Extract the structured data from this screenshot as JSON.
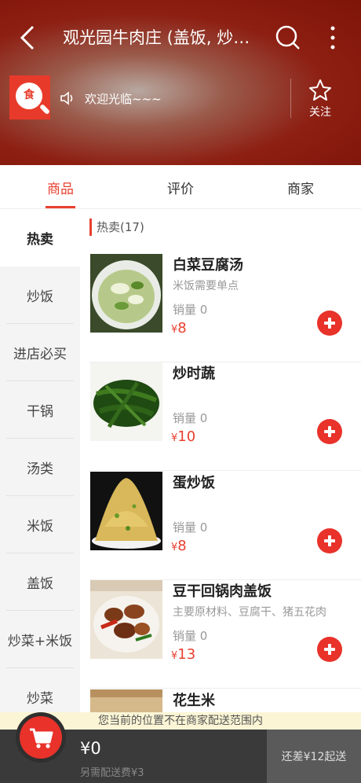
{
  "nav": {
    "title": "观光园牛肉庄 (盖饭, 炒饭, 面条, 水饺)",
    "back_icon": "chevron-left-icon",
    "search_icon": "search-icon",
    "more_icon": "more-vertical-icon"
  },
  "shop": {
    "logo_text": "食",
    "welcome": "欢迎光临~~~",
    "favorite_label": "关注"
  },
  "tabs": [
    {
      "label": "商品",
      "active": true
    },
    {
      "label": "评价",
      "active": false
    },
    {
      "label": "商家",
      "active": false
    }
  ],
  "categories": [
    {
      "label": "热卖",
      "active": true
    },
    {
      "label": "炒饭"
    },
    {
      "label": "进店必买"
    },
    {
      "label": "干锅"
    },
    {
      "label": "汤类"
    },
    {
      "label": "米饭"
    },
    {
      "label": "盖饭"
    },
    {
      "label": "炒菜+米饭"
    },
    {
      "label": "炒菜"
    }
  ],
  "section": {
    "title": "热卖(17)"
  },
  "items": [
    {
      "name": "白菜豆腐汤",
      "desc": "米饭需要单点",
      "sales": "销量 0",
      "currency": "¥",
      "price": "8"
    },
    {
      "name": "炒时蔬",
      "desc": "",
      "sales": "销量 0",
      "currency": "¥",
      "price": "10"
    },
    {
      "name": "蛋炒饭",
      "desc": "",
      "sales": "销量 0",
      "currency": "¥",
      "price": "8"
    },
    {
      "name": "豆干回锅肉盖饭",
      "desc": "主要原材料、豆腐干、猪五花肉",
      "sales": "销量 0",
      "currency": "¥",
      "price": "13"
    },
    {
      "name": "花生米",
      "desc": "",
      "sales": "",
      "currency": "",
      "price": ""
    }
  ],
  "bottom": {
    "notice": "您当前的位置不在商家配送范围内",
    "total": "¥0",
    "delivery_fee": "另需配送费¥3",
    "min_order": "还差¥12起送"
  },
  "colors": {
    "accent": "#e8402f",
    "header": "#8d1e12",
    "cart_bar": "#3a3a3a"
  }
}
